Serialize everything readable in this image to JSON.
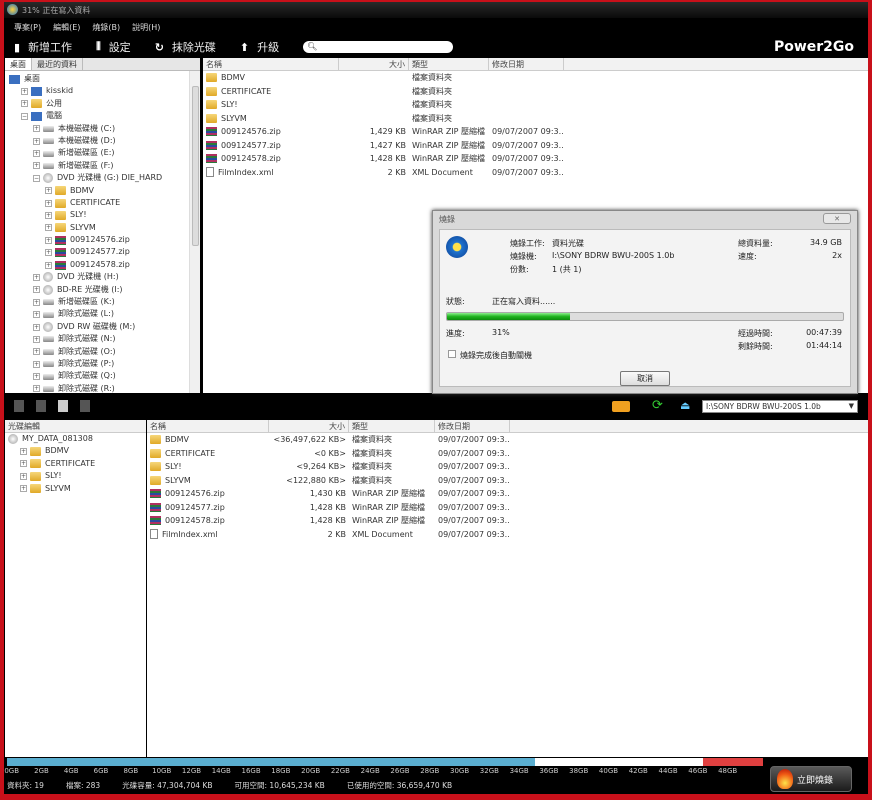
{
  "window": {
    "title": "31% 正在寫入資料"
  },
  "menu": [
    "專案(P)",
    "編輯(E)",
    "燒錄(B)",
    "說明(H)"
  ],
  "toolbar": {
    "new_task": "新增工作",
    "settings": "設定",
    "erase": "抹除光碟",
    "upgrade": "升級",
    "search_value": "",
    "brand": "Power2Go"
  },
  "browser": {
    "tabs": [
      "桌面",
      "最近的資料"
    ],
    "tree": [
      {
        "label": "桌面",
        "level": 0,
        "icon": "desktop"
      },
      {
        "label": "kisskid",
        "level": 1,
        "icon": "user"
      },
      {
        "label": "公用",
        "level": 1,
        "icon": "folder"
      },
      {
        "label": "電腦",
        "level": 1,
        "icon": "computer",
        "expanded": true
      },
      {
        "label": "本機磁碟機 (C:)",
        "level": 2,
        "icon": "drive"
      },
      {
        "label": "本機磁碟機 (D:)",
        "level": 2,
        "icon": "drive"
      },
      {
        "label": "新增磁碟區 (E:)",
        "level": 2,
        "icon": "drive"
      },
      {
        "label": "新增磁碟區 (F:)",
        "level": 2,
        "icon": "drive"
      },
      {
        "label": "DVD 光碟機 (G:) DIE_HARD",
        "level": 2,
        "icon": "disc",
        "expanded": true
      },
      {
        "label": "BDMV",
        "level": 3,
        "icon": "folder"
      },
      {
        "label": "CERTIFICATE",
        "level": 3,
        "icon": "folder"
      },
      {
        "label": "SLY!",
        "level": 3,
        "icon": "folder"
      },
      {
        "label": "SLYVM",
        "level": 3,
        "icon": "folder"
      },
      {
        "label": "009124576.zip",
        "level": 3,
        "icon": "zip"
      },
      {
        "label": "009124577.zip",
        "level": 3,
        "icon": "zip"
      },
      {
        "label": "009124578.zip",
        "level": 3,
        "icon": "zip"
      },
      {
        "label": "DVD 光碟機 (H:)",
        "level": 2,
        "icon": "disc"
      },
      {
        "label": "BD-RE 光碟機 (I:)",
        "level": 2,
        "icon": "disc"
      },
      {
        "label": "新增磁碟區 (K:)",
        "level": 2,
        "icon": "drive"
      },
      {
        "label": "卸除式磁碟 (L:)",
        "level": 2,
        "icon": "drive"
      },
      {
        "label": "DVD RW 磁碟機 (M:)",
        "level": 2,
        "icon": "disc"
      },
      {
        "label": "卸除式磁碟 (N:)",
        "level": 2,
        "icon": "drive"
      },
      {
        "label": "卸除式磁碟 (O:)",
        "level": 2,
        "icon": "drive"
      },
      {
        "label": "卸除式磁碟 (P:)",
        "level": 2,
        "icon": "drive"
      },
      {
        "label": "卸除式磁碟 (Q:)",
        "level": 2,
        "icon": "drive"
      },
      {
        "label": "卸除式磁碟 (R:)",
        "level": 2,
        "icon": "drive"
      }
    ],
    "columns": [
      "名稱",
      "大小",
      "類型",
      "修改日期"
    ],
    "files": [
      {
        "name": "BDMV",
        "size": "",
        "type": "檔案資料夾",
        "date": "",
        "icon": "folder"
      },
      {
        "name": "CERTIFICATE",
        "size": "",
        "type": "檔案資料夾",
        "date": "",
        "icon": "folder"
      },
      {
        "name": "SLY!",
        "size": "",
        "type": "檔案資料夾",
        "date": "",
        "icon": "folder"
      },
      {
        "name": "SLYVM",
        "size": "",
        "type": "檔案資料夾",
        "date": "",
        "icon": "folder"
      },
      {
        "name": "009124576.zip",
        "size": "1,429 KB",
        "type": "WinRAR ZIP 壓縮檔",
        "date": "09/07/2007 09:3...",
        "icon": "zip"
      },
      {
        "name": "009124577.zip",
        "size": "1,427 KB",
        "type": "WinRAR ZIP 壓縮檔",
        "date": "09/07/2007 09:3...",
        "icon": "zip"
      },
      {
        "name": "009124578.zip",
        "size": "1,428 KB",
        "type": "WinRAR ZIP 壓縮檔",
        "date": "09/07/2007 09:3...",
        "icon": "zip"
      },
      {
        "name": "FilmIndex.xml",
        "size": "2 KB",
        "type": "XML Document",
        "date": "09/07/2007 09:3...",
        "icon": "xml"
      }
    ]
  },
  "dialog": {
    "title": "燒錄",
    "task_label": "燒錄工作:",
    "task": "資料光碟",
    "burner_label": "燒錄機:",
    "burner": "I:\\SONY BDRW BWU-200S 1.0b",
    "copies_label": "份數:",
    "copies": "1 (共 1)",
    "total_label": "總資料量:",
    "total": "34.9 GB",
    "speed_label": "速度:",
    "speed": "2x",
    "status_label": "狀態:",
    "status": "正在寫入資料......",
    "progress_label": "進度:",
    "progress_text": "31%",
    "progress": 31,
    "elapsed_label": "經過時間:",
    "elapsed": "00:47:39",
    "remaining_label": "剩餘時間:",
    "remaining": "01:44:14",
    "auto_shutdown": "燒錄完成後自動關機",
    "auto_shutdown_checked": false,
    "cancel": "取消"
  },
  "disc": {
    "drive": "I:\\SONY BDRW BWU-200S 1.0b",
    "tree_header": "光碟編輯",
    "tree": [
      {
        "label": "MY_DATA_081308",
        "level": 0,
        "icon": "disc"
      },
      {
        "label": "BDMV",
        "level": 1,
        "icon": "folder"
      },
      {
        "label": "CERTIFICATE",
        "level": 1,
        "icon": "folder"
      },
      {
        "label": "SLY!",
        "level": 1,
        "icon": "folder"
      },
      {
        "label": "SLYVM",
        "level": 1,
        "icon": "folder"
      }
    ],
    "columns": [
      "名稱",
      "大小",
      "類型",
      "修改日期"
    ],
    "files": [
      {
        "name": "BDMV",
        "size": "<36,497,622 KB>",
        "type": "檔案資料夾",
        "date": "09/07/2007 09:3...",
        "icon": "folder"
      },
      {
        "name": "CERTIFICATE",
        "size": "<0 KB>",
        "type": "檔案資料夾",
        "date": "09/07/2007 09:3...",
        "icon": "folder"
      },
      {
        "name": "SLY!",
        "size": "<9,264 KB>",
        "type": "檔案資料夾",
        "date": "09/07/2007 09:3...",
        "icon": "folder"
      },
      {
        "name": "SLYVM",
        "size": "<122,880 KB>",
        "type": "檔案資料夾",
        "date": "09/07/2007 09:3...",
        "icon": "folder"
      },
      {
        "name": "009124576.zip",
        "size": "1,430 KB",
        "type": "WinRAR ZIP 壓縮檔",
        "date": "09/07/2007 09:3...",
        "icon": "zip"
      },
      {
        "name": "009124577.zip",
        "size": "1,428 KB",
        "type": "WinRAR ZIP 壓縮檔",
        "date": "09/07/2007 09:3...",
        "icon": "zip"
      },
      {
        "name": "009124578.zip",
        "size": "1,428 KB",
        "type": "WinRAR ZIP 壓縮檔",
        "date": "09/07/2007 09:3...",
        "icon": "zip"
      },
      {
        "name": "FilmIndex.xml",
        "size": "2 KB",
        "type": "XML Document",
        "date": "09/07/2007 09:3...",
        "icon": "xml"
      }
    ]
  },
  "capacity": {
    "ticks": [
      "0GB",
      "2GB",
      "4GB",
      "6GB",
      "8GB",
      "10GB",
      "12GB",
      "14GB",
      "16GB",
      "18GB",
      "20GB",
      "22GB",
      "24GB",
      "26GB",
      "28GB",
      "30GB",
      "32GB",
      "34GB",
      "36GB",
      "38GB",
      "40GB",
      "42GB",
      "44GB",
      "46GB",
      "48GB"
    ],
    "max_gb": 50,
    "used_gb": 34.9,
    "warn_from_gb": 46,
    "colors": {
      "used": "#5aaed0",
      "free": "#ffffff",
      "warn": "#e04040"
    }
  },
  "status": {
    "folders": "資料夾: 19",
    "files": "檔案: 283",
    "capacity": "光碟容量: 47,304,704 KB",
    "free": "可用空間: 10,645,234 KB",
    "used": "已使用的空間: 36,659,470 KB"
  },
  "burn_button": "立即燒錄"
}
